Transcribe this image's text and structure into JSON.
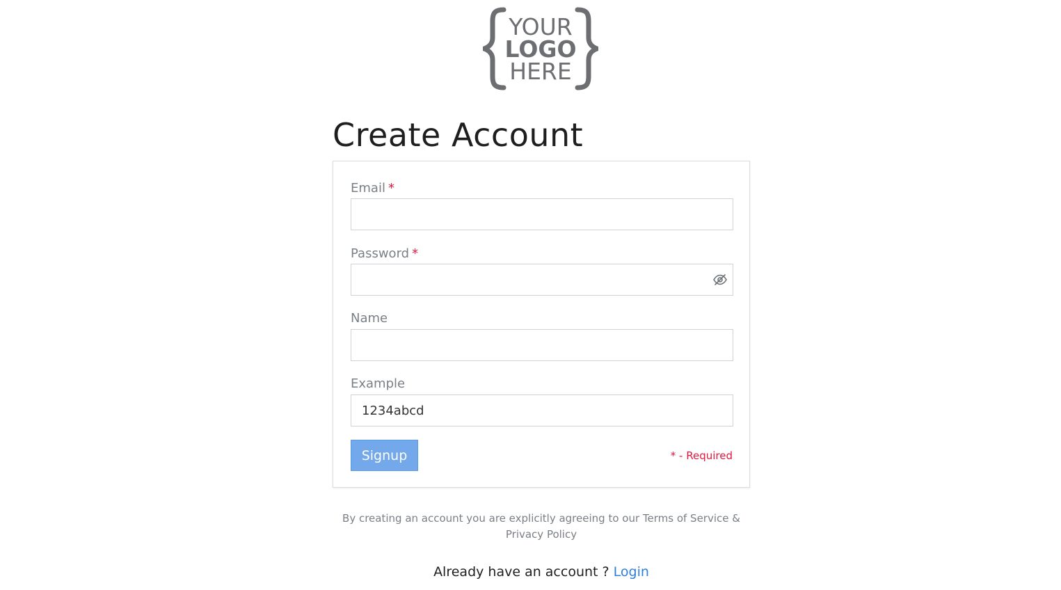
{
  "logo": {
    "line1": "YOUR",
    "line2": "LOGO",
    "line3": "HERE",
    "color": "#6d6e71"
  },
  "page_title": "Create Account",
  "form": {
    "email_label": "Email",
    "password_label": "Password",
    "name_label": "Name",
    "example_label": "Example",
    "required_marker": "*",
    "email_value": "",
    "password_value": "",
    "name_value": "",
    "example_value": "1234abcd",
    "password_toggle_icon": "eye-slash-icon",
    "signup_label": "Signup",
    "required_note": "* - Required"
  },
  "footer": {
    "terms_text": "By creating an account you are explicitly agreeing to our Terms of Service & Privacy Policy",
    "login_prompt": "Already have an account ?",
    "login_link": "Login"
  },
  "colors": {
    "accent": "#2f7fd8",
    "button": "#73a9ea",
    "required": "#e3173e",
    "label": "#7a7f86"
  }
}
